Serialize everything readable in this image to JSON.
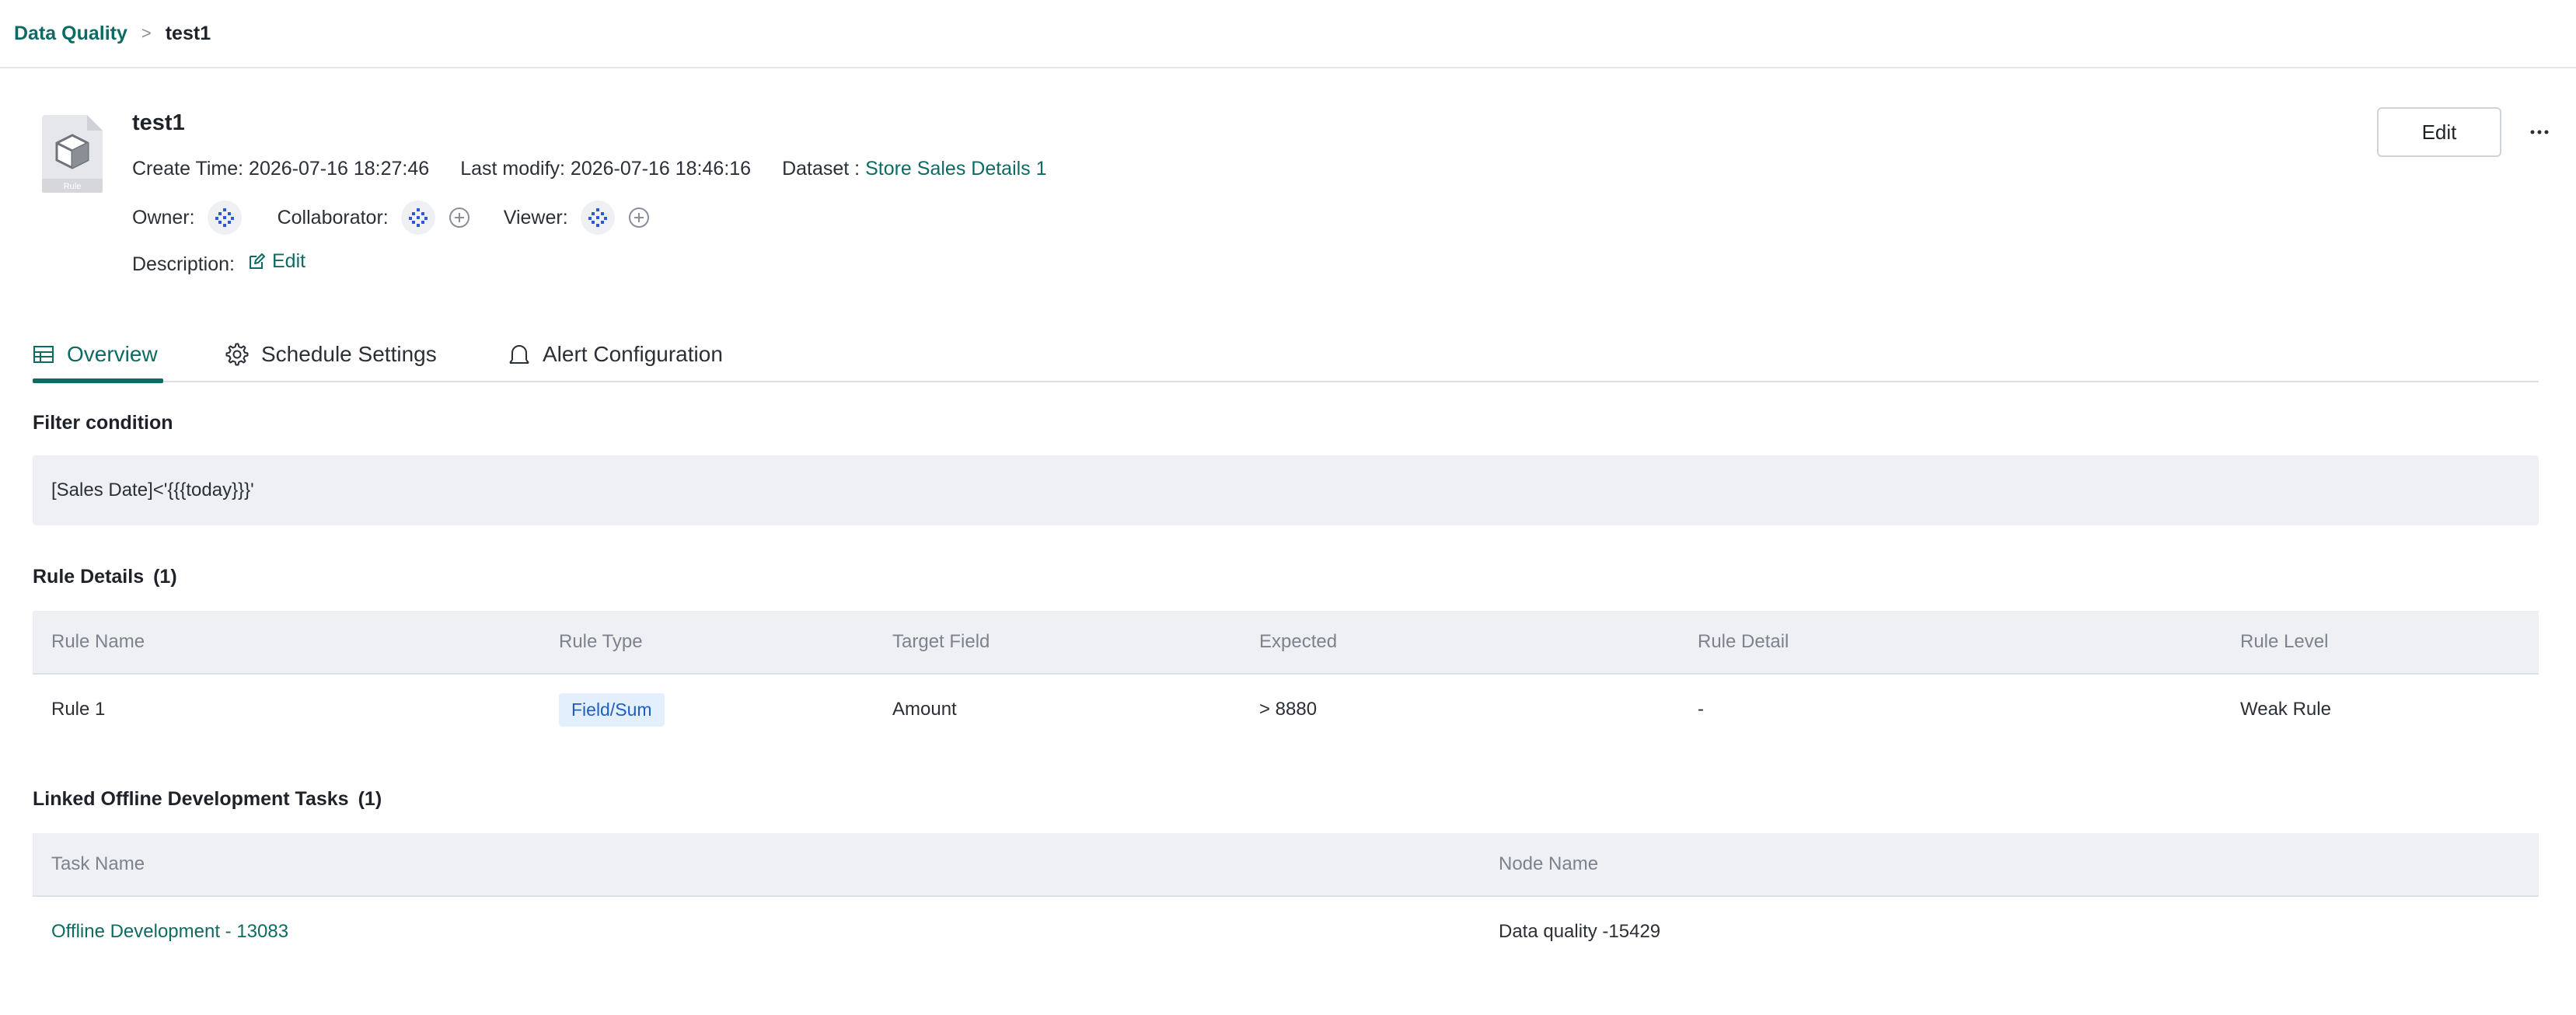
{
  "breadcrumb": {
    "root": "Data Quality",
    "separator": ">",
    "current": "test1"
  },
  "header": {
    "title": "test1",
    "icon_caption": "Rule",
    "create_time": "Create Time: 2026-07-16 18:27:46",
    "last_modify": "Last modify: 2026-07-16 18:46:16",
    "dataset_label": "Dataset : ",
    "dataset_value": "Store Sales Details 1",
    "owner_label": "Owner:",
    "collaborator_label": "Collaborator:",
    "viewer_label": "Viewer:",
    "description_label": "Description:",
    "description_edit": "Edit",
    "edit_button": "Edit",
    "more_icon": "ellipsis-icon"
  },
  "tabs": [
    {
      "label": "Overview",
      "icon": "table-icon",
      "active": true
    },
    {
      "label": "Schedule Settings",
      "icon": "gear-icon",
      "active": false
    },
    {
      "label": "Alert Configuration",
      "icon": "bell-icon",
      "active": false
    }
  ],
  "filter": {
    "title": "Filter condition",
    "value": "[Sales Date]<'{{{today}}}'"
  },
  "rule_details": {
    "title": "Rule Details",
    "count": "(1)",
    "columns": [
      "Rule Name",
      "Rule Type",
      "Target Field",
      "Expected",
      "Rule Detail",
      "Rule Level"
    ],
    "rows": [
      {
        "name": "Rule 1",
        "type": "Field/Sum",
        "target": "Amount",
        "expected": "> 8880",
        "detail": "-",
        "level": "Weak Rule"
      }
    ]
  },
  "linked_tasks": {
    "title": "Linked Offline Development Tasks",
    "count": "(1)",
    "columns": [
      "Task Name",
      "Node Name"
    ],
    "rows": [
      {
        "task": "Offline Development - 13083",
        "node": "Data quality -15429"
      }
    ]
  },
  "colors": {
    "accent": "#0e6b63",
    "tag_bg": "#e3effd",
    "tag_text": "#1d5fbf",
    "panel_bg": "#eff0f4"
  }
}
